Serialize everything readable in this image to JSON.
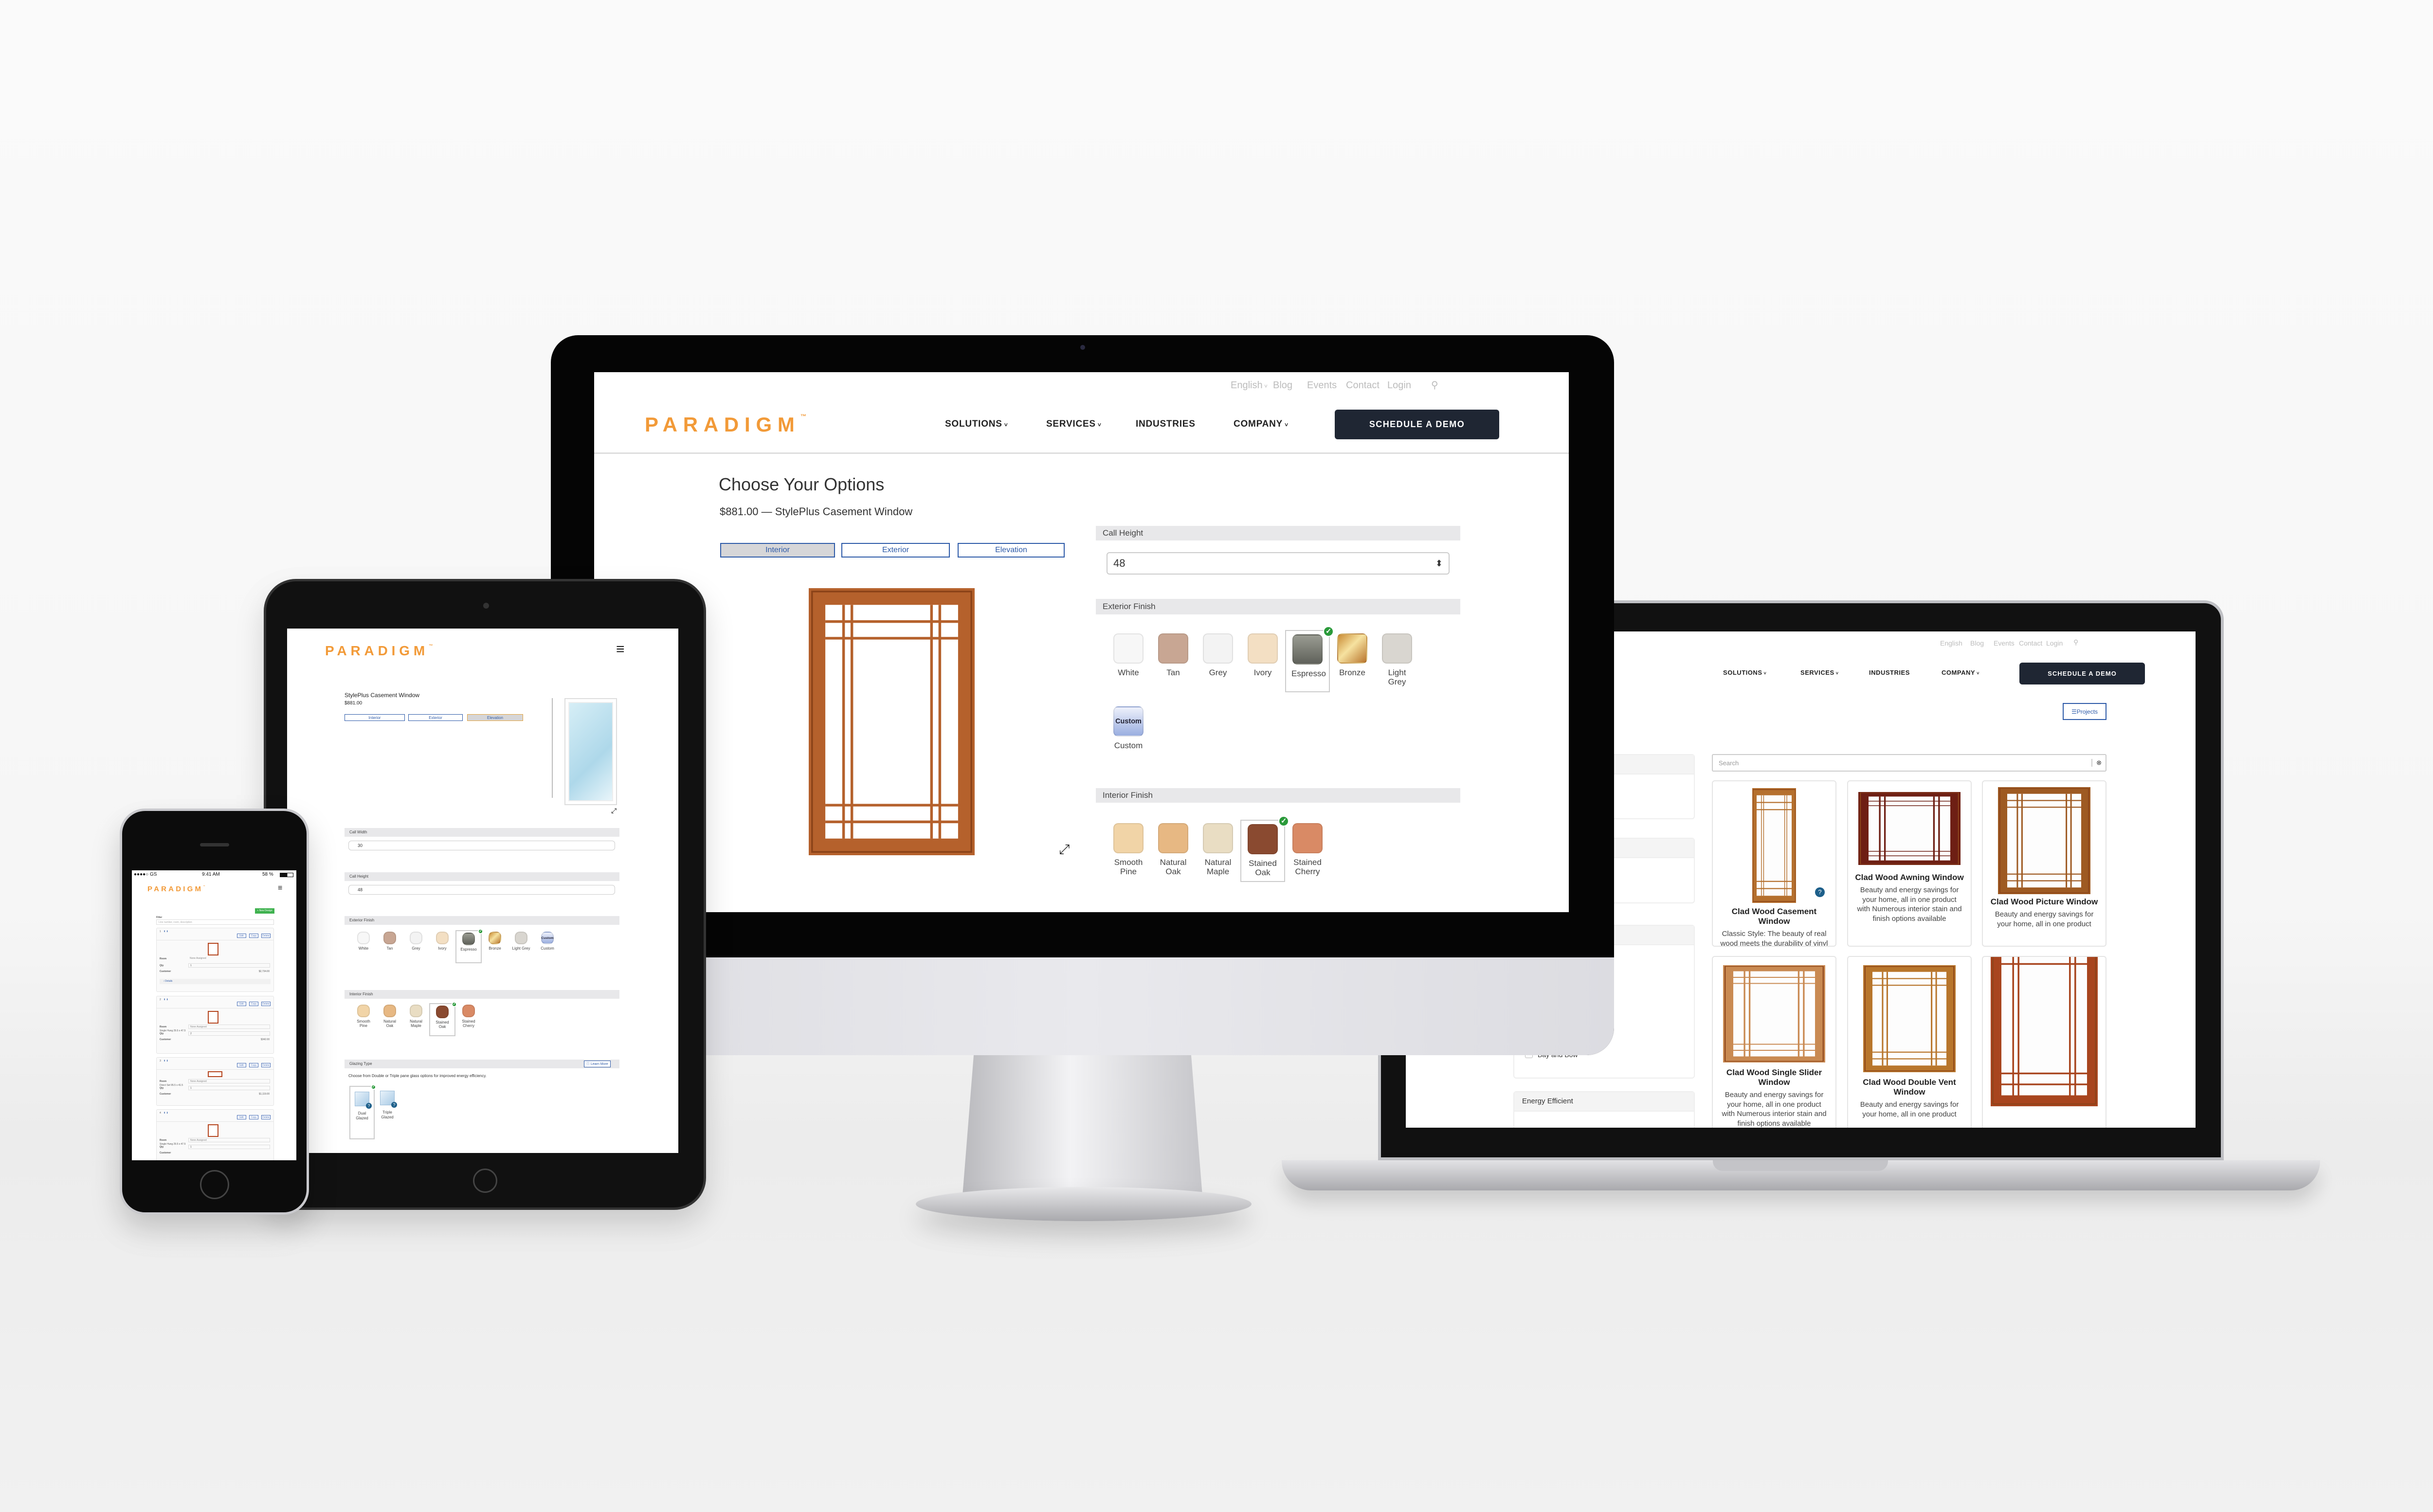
{
  "brand": {
    "logo": "PARADIGM",
    "tm": "™",
    "color": "#f29a38"
  },
  "desktop": {
    "utility_links": [
      "English",
      "Blog",
      "Events",
      "Contact",
      "Login"
    ],
    "nav": [
      {
        "label": "SOLUTIONS",
        "dropdown": true
      },
      {
        "label": "SERVICES",
        "dropdown": true
      },
      {
        "label": "INDUSTRIES",
        "dropdown": false
      },
      {
        "label": "COMPANY",
        "dropdown": true
      }
    ],
    "cta": "SCHEDULE A DEMO",
    "title": "Choose Your Options",
    "subtitle": "$881.00 — StylePlus Casement Window",
    "view_tabs": [
      "Interior",
      "Exterior",
      "Elevation"
    ],
    "call_height": {
      "label": "Call Height",
      "value": "48"
    },
    "exterior_finish": {
      "label": "Exterior Finish",
      "selected": "Espresso",
      "options": [
        {
          "name": "White",
          "color": "#f7f7f7"
        },
        {
          "name": "Tan",
          "color": "#c8a693"
        },
        {
          "name": "Grey",
          "color": "#f3f3f3"
        },
        {
          "name": "Ivory",
          "color": "#f3dfc3"
        },
        {
          "name": "Espresso",
          "color": "#7a7c72"
        },
        {
          "name": "Bronze",
          "color": "#dca24a"
        },
        {
          "name": "Light Grey",
          "color": "#d9d6d0"
        },
        {
          "name": "Custom",
          "color": "#a9b8e2",
          "swatch_text": "Custom"
        }
      ]
    },
    "interior_finish": {
      "label": "Interior Finish",
      "selected": "Stained Oak",
      "options": [
        {
          "name": "Smooth Pine",
          "color": "#f1d4a7"
        },
        {
          "name": "Natural Oak",
          "color": "#e7b883"
        },
        {
          "name": "Natural Maple",
          "color": "#e9ddc3"
        },
        {
          "name": "Stained Oak",
          "color": "#8a4a30"
        },
        {
          "name": "Stained Cherry",
          "color": "#d98a65"
        }
      ]
    },
    "wood_color": "#b5612c"
  },
  "tablet": {
    "product": "StylePlus Casement Window",
    "price": "$881.00",
    "view_tabs": [
      "Interior",
      "Exterior",
      "Elevation"
    ],
    "active_tab": "Elevation",
    "call_width": {
      "label": "Call Width",
      "value": "30"
    },
    "call_height": {
      "label": "Call Height",
      "value": "48"
    },
    "exterior_label": "Exterior Finish",
    "interior_label": "Interior Finish",
    "glazing": {
      "label": "Glazing Type",
      "learn_more": "Learn More",
      "description": "Choose from Double or Triple pane glass options for improved energy efficiency.",
      "selected": "Dual Glazed",
      "options": [
        "Dual Glazed",
        "Triple Glazed"
      ]
    }
  },
  "laptop": {
    "utility_links": [
      "English",
      "Blog",
      "Events",
      "Contact",
      "Login"
    ],
    "projects": "Projects",
    "search_placeholder": "Search",
    "filter_option": "Bay and Bow",
    "filter_section": "Energy Efficient",
    "products": [
      {
        "name": "Clad Wood Casement Window",
        "description": "Classic Style: The beauty of real wood meets the durability of vinyl"
      },
      {
        "name": "Clad Wood Awning Window",
        "description": "Beauty and energy savings for your home, all in one product with Numerous interior stain and finish options available"
      },
      {
        "name": "Clad Wood Picture Window",
        "description": "Beauty and energy savings for your home, all in one product"
      },
      {
        "name": "Clad Wood Single Slider Window",
        "description": "Beauty and energy savings for your home, all in one product with Numerous interior stain and finish options available"
      },
      {
        "name": "Clad Wood Double Vent Window",
        "description": "Beauty and energy savings for your home, all in one product"
      },
      {
        "name": "",
        "description": ""
      }
    ]
  },
  "phone": {
    "status": {
      "carrier": "●●●●○ GS",
      "time": "9:41 AM",
      "battery": "58 %"
    },
    "new_design": "+ New Design",
    "filter_label": "Filter",
    "filter_placeholder": "Line number, room, description",
    "buttons": [
      "Edit",
      "Copy",
      "Delete"
    ],
    "labels": {
      "room": "Room",
      "qty": "Qty",
      "customer": "Customer",
      "details": "Details"
    },
    "cards": [
      {
        "num": "1",
        "room": "None Assigned",
        "desc": "",
        "qty": "1",
        "price": "$2,734.00"
      },
      {
        "num": "2",
        "room": "None Assigned",
        "desc": "Single Hung 29.5 x 47.5",
        "qty": "2",
        "price": "$342.00"
      },
      {
        "num": "3",
        "room": "None Assigned",
        "desc": "Direct Set 95.5 x 41.5",
        "qty": "1",
        "price": "$1,119.00"
      },
      {
        "num": "4",
        "room": "None Assigned",
        "desc": "Single Hung 29.5 x 47.5",
        "qty": "1",
        "price": ""
      }
    ]
  }
}
